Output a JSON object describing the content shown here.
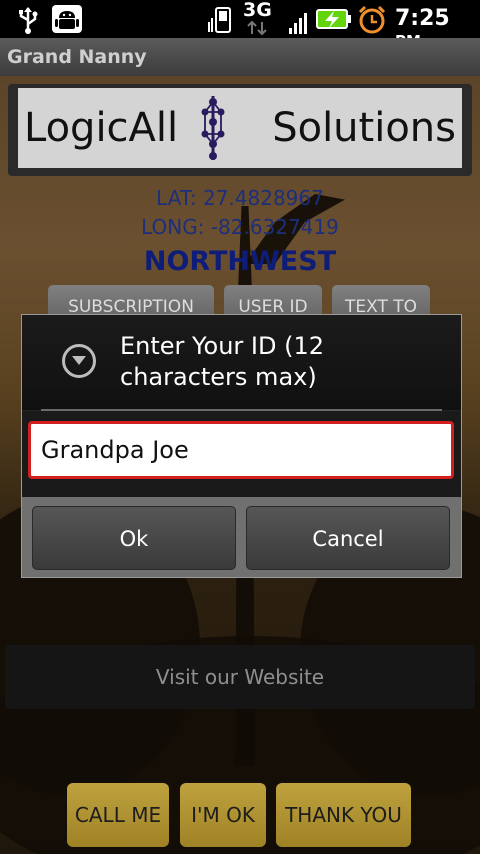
{
  "status_bar": {
    "network": "3G",
    "time": "7:25",
    "meridiem": "PM",
    "icons": [
      "usb-icon",
      "android-debug-icon",
      "signal-strength-icon",
      "battery-charging-icon",
      "alarm-clock-icon"
    ],
    "colors": {
      "battery": "#62d50a",
      "alarm": "#f08f2d"
    }
  },
  "app": {
    "title": "Grand Nanny"
  },
  "logo": {
    "left_text": "LogicAll",
    "right_text": "Solutions"
  },
  "location": {
    "lat": "LAT: 27.4828967",
    "long": "LONG: -82.6327419",
    "direction": "NORTHWEST"
  },
  "top_buttons": {
    "subscription": "SUBSCRIPTION",
    "user_id": "USER ID",
    "text_to": "TEXT TO"
  },
  "visit_website": "Visit our Website",
  "bottom_buttons": {
    "call_me": "CALL ME",
    "im_ok": "I'M OK",
    "thank_you": "THANK YOU"
  },
  "dialog": {
    "title": "Enter Your ID (12 characters max)",
    "input_value": "Grandpa Joe",
    "ok_label": "Ok",
    "cancel_label": "Cancel"
  }
}
